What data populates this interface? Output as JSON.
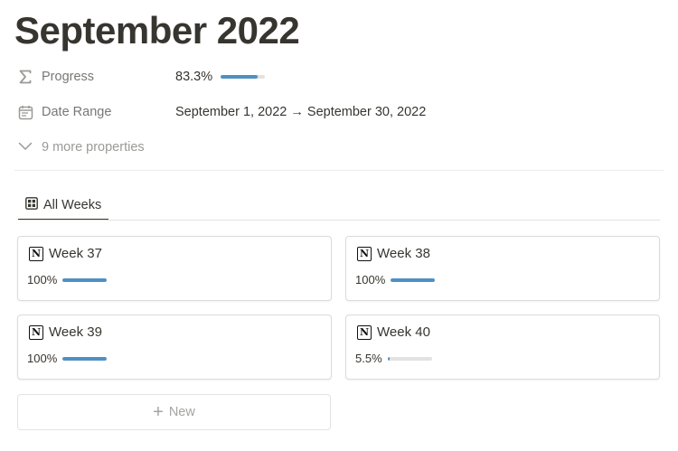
{
  "page": {
    "title": "September 2022"
  },
  "properties": [
    {
      "name": "Progress",
      "icon": "sigma-icon",
      "value": "83.3%",
      "progress": 0.833
    },
    {
      "name": "Date Range",
      "icon": "calendar-icon",
      "value": "September 1, 2022 → September 30, 2022"
    }
  ],
  "more_properties": "9 more properties",
  "tabs": [
    {
      "label": "All Weeks",
      "icon": "gallery-icon",
      "active": true
    }
  ],
  "cards": [
    {
      "title": "Week 37",
      "icon": "notion-icon",
      "progress_label": "100%",
      "progress": 1.0
    },
    {
      "title": "Week 38",
      "icon": "notion-icon",
      "progress_label": "100%",
      "progress": 1.0
    },
    {
      "title": "Week 39",
      "icon": "notion-icon",
      "progress_label": "100%",
      "progress": 1.0
    },
    {
      "title": "Week 40",
      "icon": "notion-icon",
      "progress_label": "5.5%",
      "progress": 0.055
    }
  ],
  "new_button": {
    "plus": "+",
    "label": "New"
  },
  "colors": {
    "accent": "#4f90c4",
    "track": "#e3e2e0",
    "text": "#37352f",
    "muted": "#787774"
  }
}
